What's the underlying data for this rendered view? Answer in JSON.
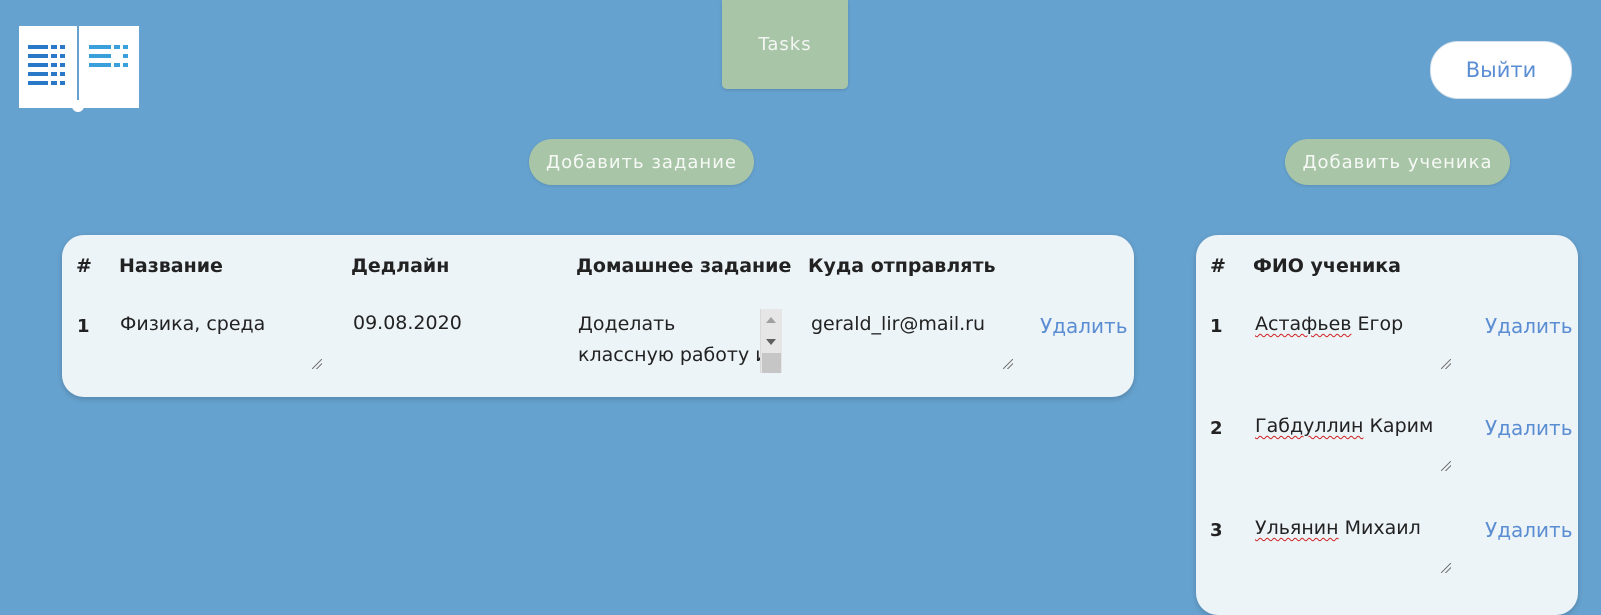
{
  "header": {
    "tasks_tab": "Tasks",
    "logout": "Выйти"
  },
  "actions": {
    "add_task": "Добавить задание",
    "add_student": "Добавить ученика"
  },
  "tasks_table": {
    "headers": [
      "#",
      "Название",
      "Дедлайн",
      "Домашнее задание",
      "Куда отправлять"
    ],
    "rows": [
      {
        "num": "1",
        "name": "Физика, среда",
        "deadline": "09.08.2020",
        "homework_line1": "Доделать",
        "homework_line2": "классную работу и",
        "send_to": "gerald_lir@mail.ru",
        "delete": "Удалить"
      }
    ]
  },
  "students_table": {
    "headers": [
      "#",
      "ФИО ученика"
    ],
    "rows": [
      {
        "num": "1",
        "surname": "Астафьев",
        "given": "Егор",
        "delete": "Удалить"
      },
      {
        "num": "2",
        "surname": "Габдуллин",
        "given": "Карим",
        "delete": "Удалить"
      },
      {
        "num": "3",
        "surname": "Ульянин",
        "given": "Михаил",
        "delete": "Удалить"
      }
    ]
  },
  "colors": {
    "background": "#66a2cf",
    "green_button": "#a8c6a7",
    "link": "#5b8dd2",
    "card": "#edf4f8",
    "logo_dark": "#2a78c8",
    "logo_light": "#3aa0dc"
  },
  "icons": {
    "logo": "open-book-icon"
  }
}
